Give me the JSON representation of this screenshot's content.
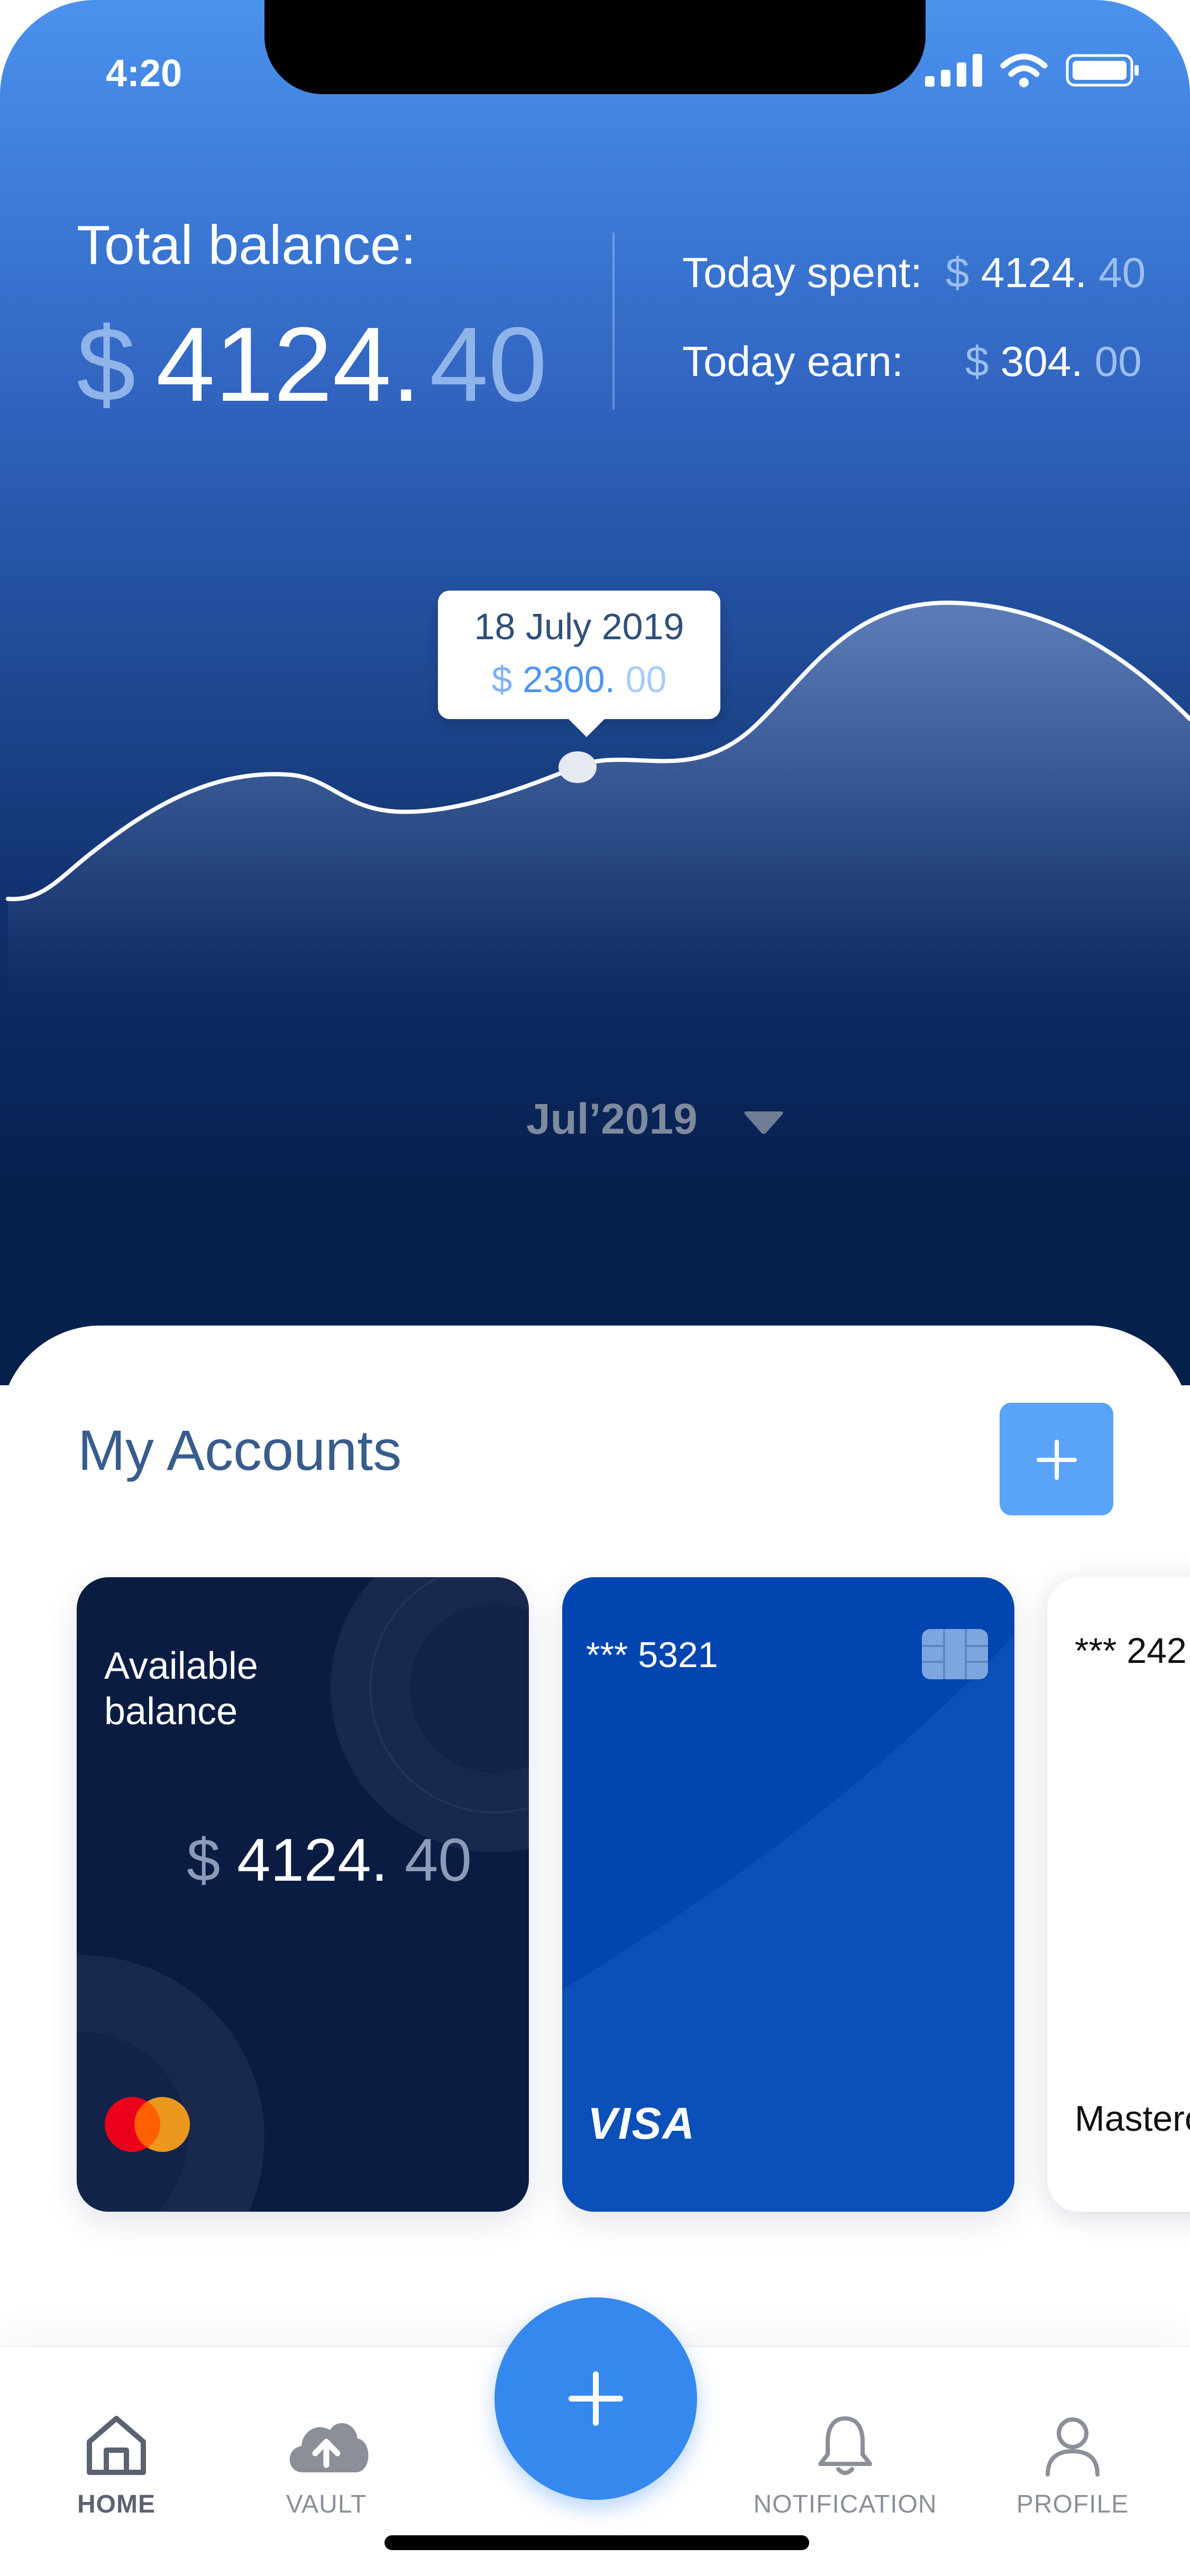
{
  "status_bar": {
    "time": "4:20"
  },
  "balance": {
    "label": "Total balance:",
    "currency": "$",
    "integer": "4124.",
    "decimal": "40",
    "today_spent": {
      "label": "Today spent:",
      "currency": "$",
      "integer": "4124.",
      "decimal": "40"
    },
    "today_earn": {
      "label": "Today earn:",
      "currency": "$",
      "integer": "304.",
      "decimal": "00"
    }
  },
  "chart_tooltip": {
    "date": "18 July 2019",
    "currency": "$",
    "integer": "2300.",
    "decimal": "00"
  },
  "month_selector": {
    "label": "Jul’2019"
  },
  "accounts": {
    "title": "My Accounts",
    "cards": [
      {
        "type": "balance",
        "label": "Available balance",
        "currency": "$",
        "integer": "4124.",
        "decimal": "40",
        "brand": "mastercard-icon"
      },
      {
        "type": "visa",
        "number": "*** 5321",
        "brand_label": "VISA"
      },
      {
        "type": "mastercard",
        "number": "*** 242",
        "brand_label": "Mastercard"
      }
    ]
  },
  "tabs": [
    {
      "label": "HOME",
      "icon": "home-icon",
      "active": true
    },
    {
      "label": "VAULT",
      "icon": "cloud-upload-icon",
      "active": false
    },
    {
      "label": "NOTIFICATION",
      "icon": "bell-icon",
      "active": false
    },
    {
      "label": "PROFILE",
      "icon": "user-icon",
      "active": false
    }
  ],
  "colors": {
    "accent": "#3588ed",
    "hero_top": "#4b91ee",
    "hero_bottom": "#06204c",
    "card_dark": "#0b1c43",
    "card_blue": "#0345b0"
  }
}
